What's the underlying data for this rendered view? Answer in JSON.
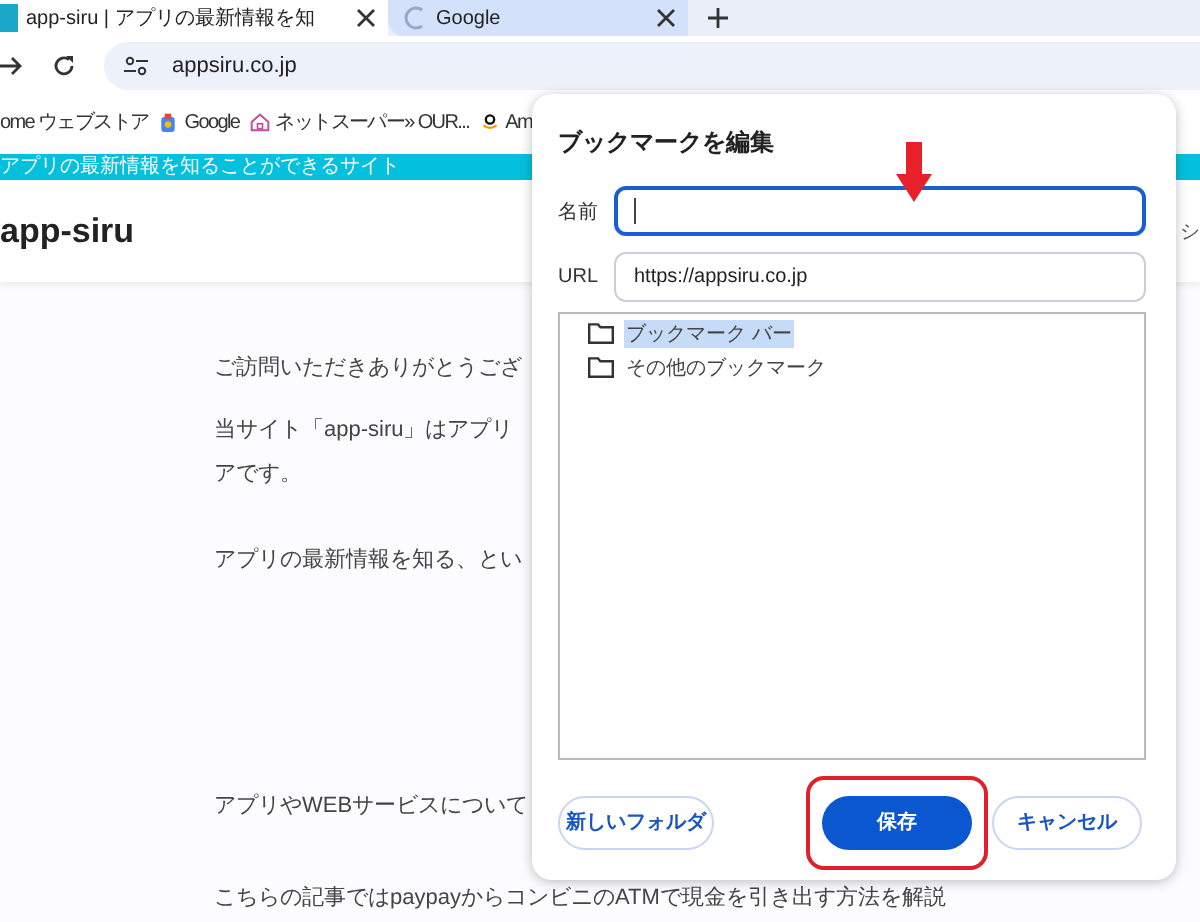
{
  "tabs": [
    {
      "label": "app-siru | アプリの最新情報を知",
      "selected": true
    },
    {
      "label": "Google",
      "selected": false
    }
  ],
  "address_bar": {
    "url": "appsiru.co.jp"
  },
  "bookmarks_bar": [
    "ome ウェブストア",
    "Google",
    "ネットスーパー» OUR...",
    "Am"
  ],
  "site": {
    "banner": "アプリの最新情報を知ることができるサイト",
    "logo": "app-siru",
    "nav": [
      "シ"
    ],
    "paragraphs": [
      [
        "ご訪問いただきありがとうござ"
      ],
      [
        "当サイト「app-siru」はアプリ",
        "アです。"
      ],
      [
        "アプリの最新情報を知る、とい"
      ],
      [
        "アプリやWEBサービスについて"
      ],
      [
        "こちらの記事ではpaypayからコンビニのATMで現金を引き出す方法を解説"
      ]
    ]
  },
  "dialog": {
    "title": "ブックマークを編集",
    "fields": [
      {
        "label": "名前",
        "focused": true
      },
      {
        "label": "URL",
        "value": "https://appsiru.co.jp",
        "focused": false
      }
    ],
    "folders": [
      {
        "label": "ブックマーク バー",
        "selected": true
      },
      {
        "label": "その他のブックマーク",
        "selected": false
      }
    ],
    "buttons": [
      {
        "label": "新しいフォルダ",
        "kind": "secondary",
        "highlighted": false
      },
      {
        "label": "保存",
        "kind": "primary",
        "highlighted": true
      },
      {
        "label": "キャンセル",
        "kind": "secondary",
        "highlighted": false
      }
    ]
  }
}
